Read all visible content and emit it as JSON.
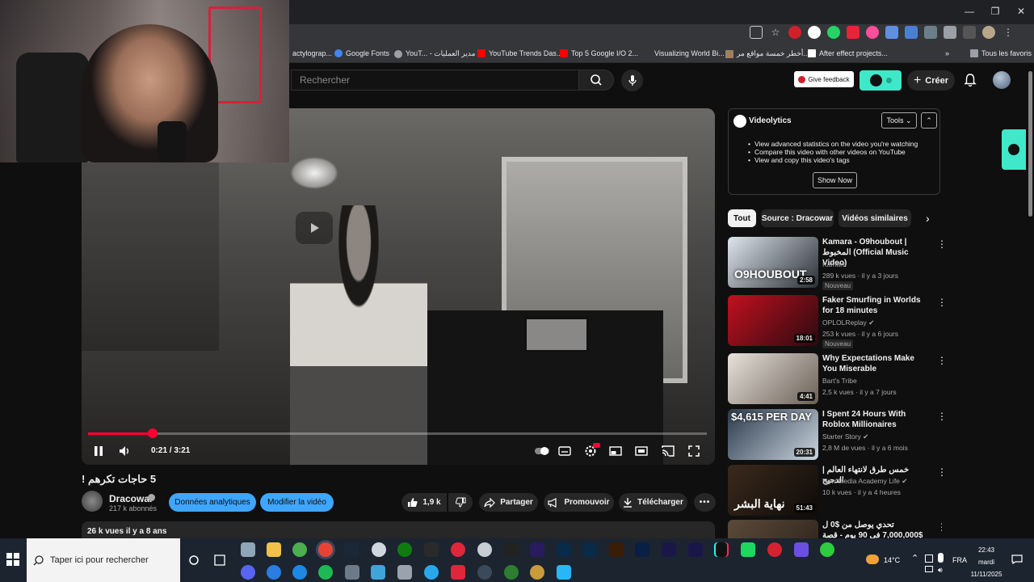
{
  "bookmarks": [
    {
      "label": "actylograp...",
      "color": "#888888"
    },
    {
      "label": "Google Fonts",
      "color": "#4285f4"
    },
    {
      "label": "YouT... - مدير العمليات",
      "color": "#9aa0a6"
    },
    {
      "label": "YouTube Trends Das...",
      "color": "#ff0000"
    },
    {
      "label": "Top 5 Google I/O 2...",
      "color": "#ff0000"
    },
    {
      "label": "Visualizing World Bi...",
      "color": "#35363a"
    },
    {
      "label": "أخطر خمسة مواقع مر...",
      "color": "#a08060"
    },
    {
      "label": "After effect projects...",
      "color": "#ffffff"
    }
  ],
  "bookmarks_all": "Tous les favoris",
  "search": {
    "placeholder": "Rechercher"
  },
  "header": {
    "feedback": "Give feedback",
    "create": "Créer"
  },
  "player": {
    "time": "0:21 / 3:21",
    "progress": 0.105
  },
  "video": {
    "title": "5 حاجات تكرهم !",
    "channel": "Dracowar",
    "subscribers": "217 k abonnés",
    "analytics_btn": "Données analytiques",
    "edit_btn": "Modifier la vidéo",
    "likes": "1,9 k",
    "share": "Partager",
    "promote": "Promouvoir",
    "download": "Télécharger",
    "stats": "26 k vues  il y a 8 ans"
  },
  "videolytics": {
    "title": "Videolytics",
    "tools": "Tools",
    "features": [
      "View advanced statistics on the video you're watching",
      "Compare this video with other videos on YouTube",
      "View and copy this video's tags"
    ],
    "show_now": "Show Now"
  },
  "chips": [
    "Tout",
    "Source : Dracowar",
    "Vidéos similaires"
  ],
  "recommendations": [
    {
      "title": "Kamara - O9houbout | المخبوط (Official Music Video)",
      "channel": "Kamara",
      "meta": "289 k vues · il y a 3 jours",
      "badge": "Nouveau",
      "duration": "2:58",
      "thumb_text": "O9HOUBOUT",
      "thumb_colors": [
        "#dfe6ee",
        "#2a2f36"
      ]
    },
    {
      "title": "Faker Smurfing in Worlds for 18 minutes",
      "channel": "OPLOLReplay",
      "meta": "253 k vues · il y a 6 jours",
      "badge": "Nouveau",
      "duration": "18:01",
      "thumb_text": "",
      "thumb_colors": [
        "#c2101e",
        "#2a0a10"
      ]
    },
    {
      "title": "Why Expectations Make You Miserable",
      "channel": "Bart's Tribe",
      "meta": "2,5 k vues · il y a 7 jours",
      "badge": "",
      "duration": "4:41",
      "thumb_text": "",
      "thumb_colors": [
        "#e8e2da",
        "#6a6058"
      ]
    },
    {
      "title": "I Spent 24 Hours With Roblox Millionaires",
      "channel": "Starter Story",
      "meta": "2,8 M de vues · il y a 6 mois",
      "badge": "",
      "duration": "20:31",
      "thumb_text": "$4,615 PER DAY",
      "thumb_colors": [
        "#2c3a4c",
        "#c9d4de"
      ]
    },
    {
      "title": "خمس طرق لانتهاء العالم | الدحيح",
      "channel": "New Media Academy Life",
      "meta": "10 k vues · il y a 4 heures",
      "badge": "",
      "duration": "51:43",
      "thumb_text": "نهاية البشر",
      "thumb_colors": [
        "#3a2a1c",
        "#0e0a08"
      ]
    },
    {
      "title": "تحدي يوصل من $0 ل $7,000,000 في 90 يوم - قصة حقيقية",
      "channel": "",
      "meta": "",
      "badge": "",
      "duration": "",
      "thumb_text": "",
      "thumb_colors": [
        "#5a4a3a",
        "#2a2018"
      ]
    }
  ],
  "taskbar": {
    "search_placeholder": "Taper ici pour rechercher",
    "weather": "14°C",
    "lang": "FRA",
    "time": "22:43",
    "day": "mardi",
    "date": "11/11/2025"
  }
}
